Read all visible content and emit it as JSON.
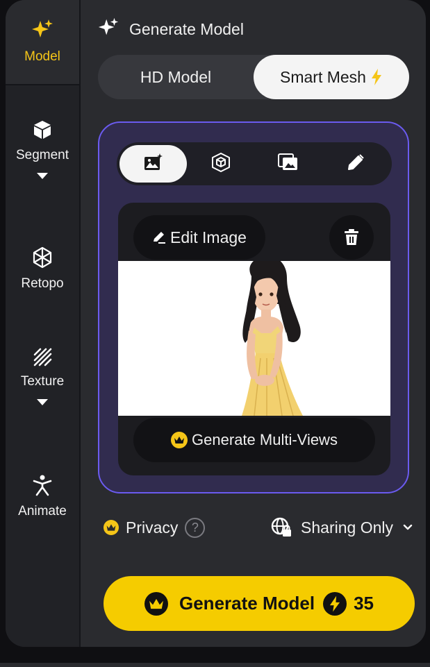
{
  "sidebar": {
    "items": [
      {
        "label": "Model",
        "icon": "sparkles-icon",
        "active": true
      },
      {
        "label": "Segment",
        "icon": "cube-icon"
      },
      {
        "label": "Retopo",
        "icon": "mesh-icon"
      },
      {
        "label": "Texture",
        "icon": "texture-icon"
      },
      {
        "label": "Animate",
        "icon": "figure-icon"
      }
    ]
  },
  "header": {
    "title": "Generate Model",
    "icon": "sparkles-icon"
  },
  "mode_toggle": {
    "hd": "HD Model",
    "smart": "Smart Mesh",
    "selected": "Smart Mesh"
  },
  "input_modes": [
    {
      "name": "image-to-3d",
      "icon": "image-add-icon",
      "active": true
    },
    {
      "name": "model",
      "icon": "cube-outline-icon"
    },
    {
      "name": "multi-image",
      "icon": "images-icon"
    },
    {
      "name": "sketch",
      "icon": "pencil-icon"
    }
  ],
  "preview": {
    "edit_label": "Edit Image",
    "multi_views_label": "Generate Multi-Views"
  },
  "privacy": {
    "label": "Privacy",
    "help": "?"
  },
  "sharing": {
    "label": "Sharing Only"
  },
  "generate": {
    "label": "Generate Model",
    "cost": "35"
  },
  "colors": {
    "accent": "#f5cc00",
    "card_border": "#6b5bf0",
    "card_bg": "#312c4f",
    "panel_bg": "#2a2b2f"
  }
}
